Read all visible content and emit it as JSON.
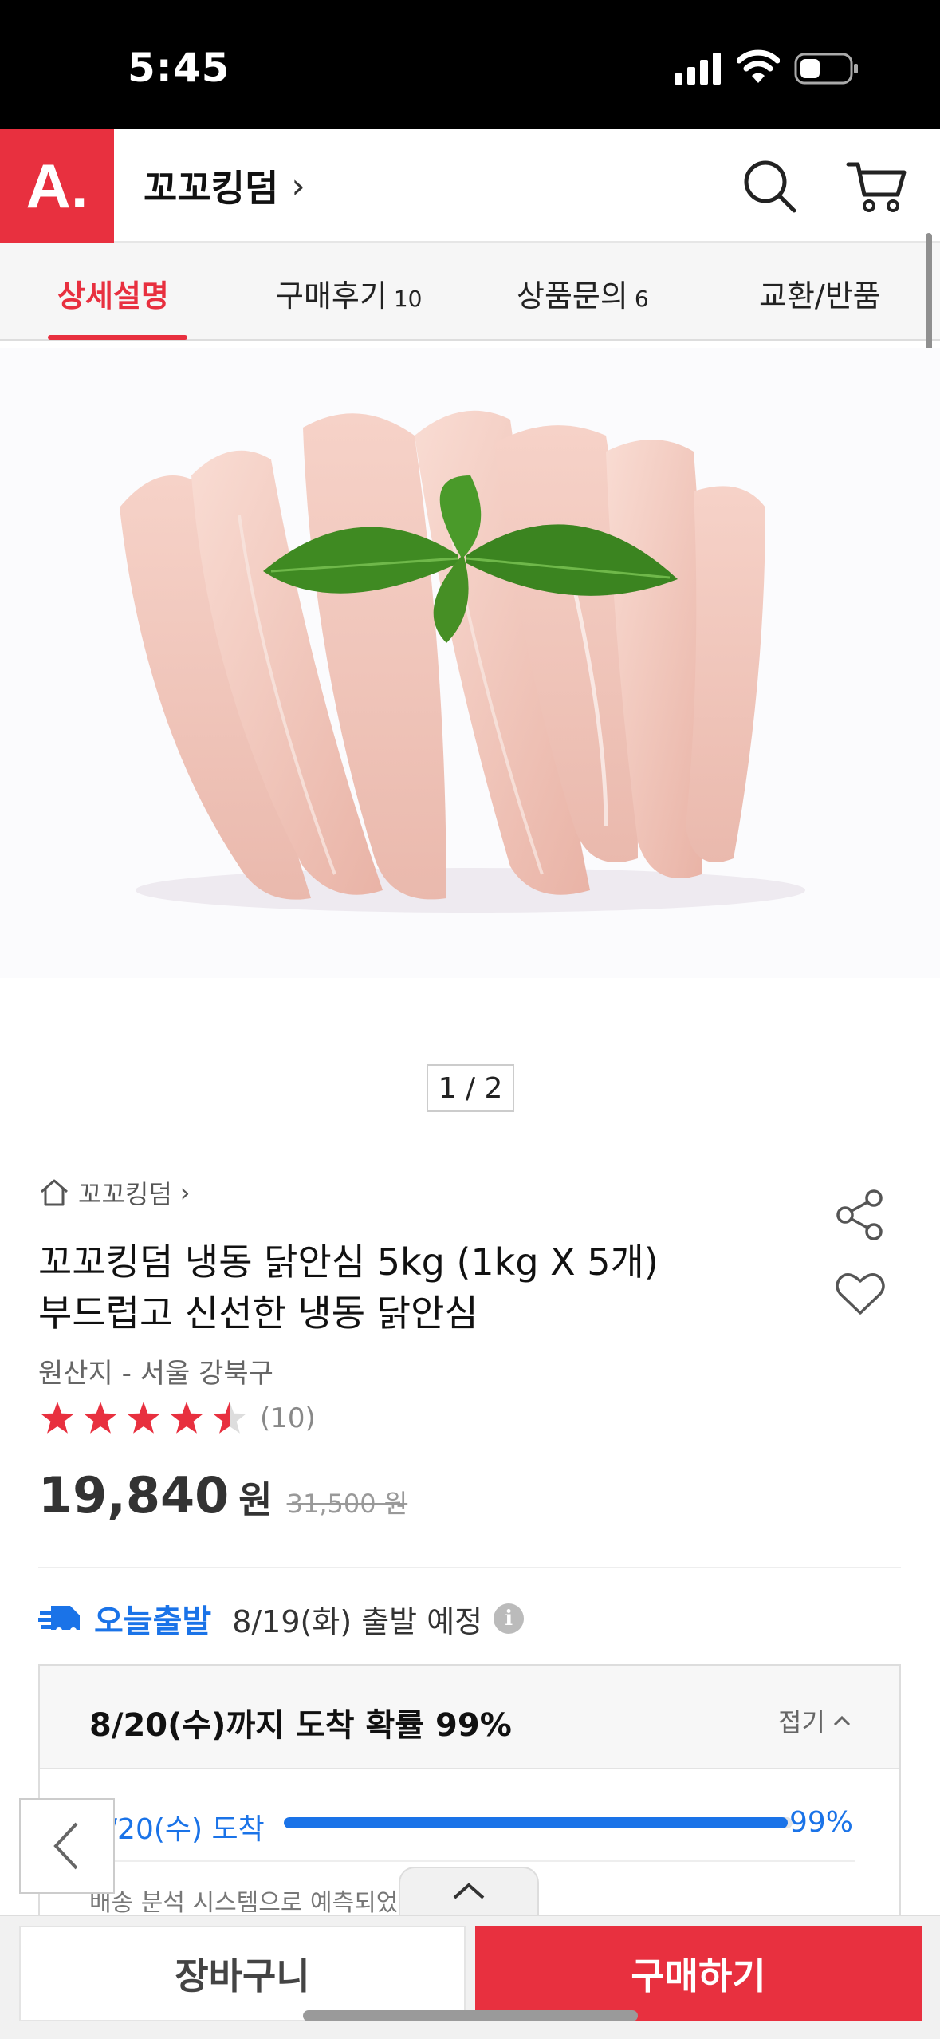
{
  "status_bar": {
    "time": "5:45"
  },
  "header": {
    "logo": "A.",
    "store_name": "꼬꼬킹덤",
    "store_chevron": "›"
  },
  "tabs": [
    {
      "label": "상세설명",
      "count": ""
    },
    {
      "label": "구매후기",
      "count": "10"
    },
    {
      "label": "상품문의",
      "count": "6"
    },
    {
      "label": "교환/반품",
      "count": ""
    }
  ],
  "gallery": {
    "pager": "1 / 2"
  },
  "product": {
    "breadcrumb": "꼬꼬킹덤",
    "breadcrumb_chevron": "›",
    "title_line1": "꼬꼬킹덤 냉동 닭안심 5kg (1kg X 5개)",
    "title_line2": "부드럽고 신선한 냉동 닭안심",
    "origin": "원산지 - 서울 강북구",
    "rating": 4.5,
    "review_count": "(10)",
    "price": "19,840",
    "price_unit": "원",
    "original_price": "31,500 원"
  },
  "delivery": {
    "badge": "오늘출발",
    "date_text": "8/19(화) 출발 예정",
    "info_icon": "i",
    "arrival_title": "8/20(수)까지 도착 확률 99%",
    "collapse_label": "접기",
    "progress_label": "8/20(수) 도착",
    "progress_value": 0.99,
    "progress_pct": "99%",
    "note": "배송 분석 시스템으로 예측되었"
  },
  "bottom_bar": {
    "cart_label": "장바구니",
    "buy_label": "구매하기"
  },
  "colors": {
    "brand": "#e8303f",
    "delivery_blue": "#1a73e8"
  },
  "icons": [
    "search-icon",
    "cart-icon",
    "home-icon",
    "share-icon",
    "heart-icon",
    "star-icon",
    "delivery-truck-icon",
    "info-icon",
    "chevron-up-icon",
    "chevron-left-icon"
  ]
}
